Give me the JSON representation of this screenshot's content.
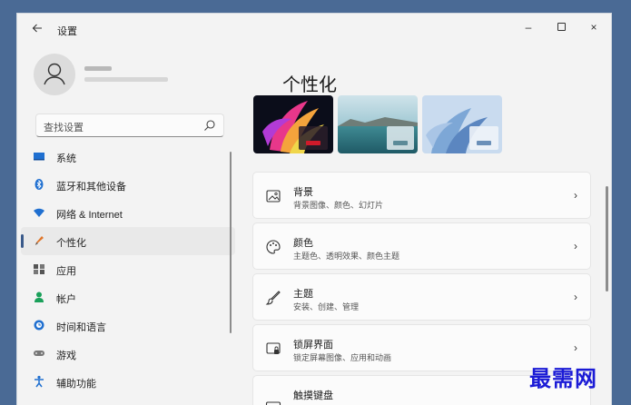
{
  "window": {
    "back_icon": "arrow-left-icon",
    "title": "设置"
  },
  "controls": {
    "minimize": "–",
    "close": "×"
  },
  "search": {
    "placeholder": "查找设置"
  },
  "nav": [
    {
      "label": "系统",
      "icon": "monitor-icon",
      "color": "#1f6fd0"
    },
    {
      "label": "蓝牙和其他设备",
      "icon": "bluetooth-icon",
      "color": "#1f6fd0"
    },
    {
      "label": "网络 & Internet",
      "icon": "wifi-icon",
      "color": "#1f6fd0"
    },
    {
      "label": "个性化",
      "icon": "pen-icon",
      "color": "#e0762a",
      "active": true
    },
    {
      "label": "应用",
      "icon": "apps-icon",
      "color": "#555555"
    },
    {
      "label": "帐户",
      "icon": "person-icon",
      "color": "#1aa05a"
    },
    {
      "label": "时间和语言",
      "icon": "globe-clock-icon",
      "color": "#1f6fd0"
    },
    {
      "label": "游戏",
      "icon": "gamepad-icon",
      "color": "#666666"
    },
    {
      "label": "辅助功能",
      "icon": "accessibility-icon",
      "color": "#1f6fd0"
    }
  ],
  "page": {
    "title": "个性化"
  },
  "cards": [
    {
      "title": "背景",
      "subtitle": "背景图像、颜色、幻灯片",
      "icon": "image-icon"
    },
    {
      "title": "颜色",
      "subtitle": "主题色、透明效果、颜色主题",
      "icon": "palette-icon"
    },
    {
      "title": "主题",
      "subtitle": "安装、创建、管理",
      "icon": "brush-icon"
    },
    {
      "title": "锁屏界面",
      "subtitle": "锁定屏幕图像、应用和动画",
      "icon": "lock-screen-icon"
    },
    {
      "title": "触摸键盘",
      "subtitle": "",
      "icon": "keyboard-icon"
    }
  ],
  "watermark": "最需网"
}
